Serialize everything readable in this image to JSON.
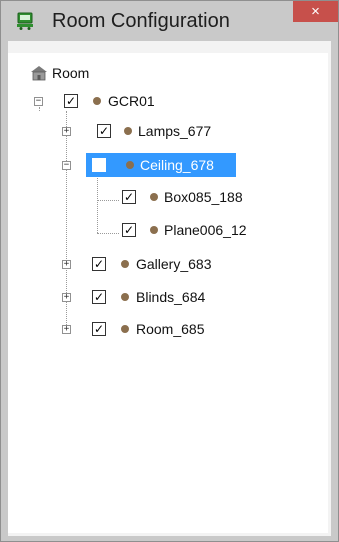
{
  "window": {
    "title": "Room Configuration",
    "close_glyph": "×"
  },
  "icons": {
    "app": "monitor-train-icon",
    "root": "room-building-icon"
  },
  "tree": {
    "root_label": "Room",
    "gcr": {
      "label": "GCR01",
      "expander": "−",
      "checked": true
    },
    "items": [
      {
        "label": "Lamps_677",
        "expander": "+",
        "checked": true
      },
      {
        "label": "Ceiling_678",
        "expander": "−",
        "checked": false,
        "selected": true
      },
      {
        "label": "Box085_188",
        "checked": true
      },
      {
        "label": "Plane006_12",
        "checked": true
      },
      {
        "label": "Gallery_683",
        "expander": "+",
        "checked": true
      },
      {
        "label": "Blinds_684",
        "expander": "+",
        "checked": true
      },
      {
        "label": "Room_685",
        "expander": "+",
        "checked": true
      }
    ],
    "check_glyph": "✓"
  },
  "colors": {
    "title_bar": "#c9c9c9",
    "close_button": "#c7504b",
    "selection": "#3399ff",
    "node_dot": "#8b6f4e"
  }
}
